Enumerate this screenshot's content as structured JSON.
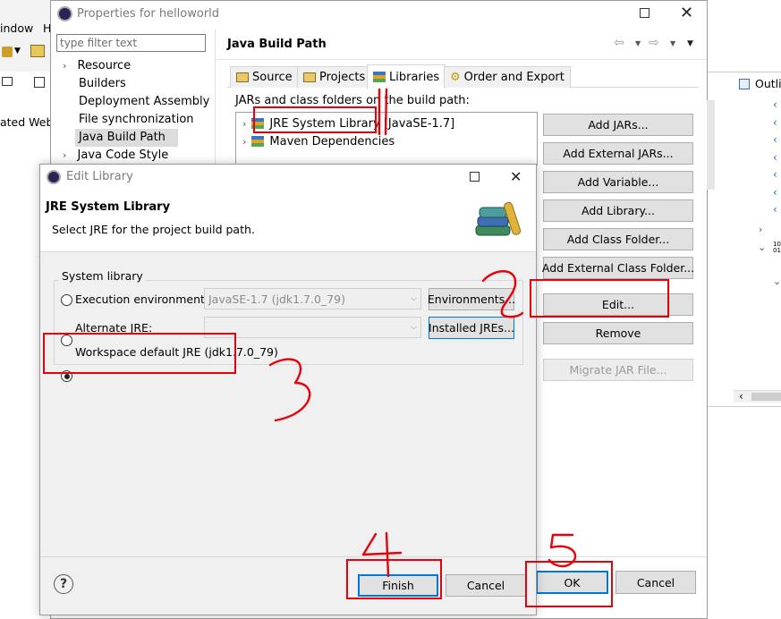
{
  "background": {
    "menu_window": "indow",
    "menu_help": "H",
    "side_text": "ated Web",
    "outline_tab": "Outli"
  },
  "properties": {
    "title": "Properties for helloworld",
    "filter_placeholder": "type filter text",
    "nav_items": [
      {
        "label": "Resource",
        "expandable": true
      },
      {
        "label": "Builders",
        "expandable": false
      },
      {
        "label": "Deployment Assembly",
        "expandable": false
      },
      {
        "label": "File synchronization",
        "expandable": false
      },
      {
        "label": "Java Build Path",
        "expandable": false,
        "selected": true
      },
      {
        "label": "Java Code Style",
        "expandable": true
      }
    ],
    "section_title": "Java Build Path",
    "tabs": [
      "Source",
      "Projects",
      "Libraries",
      "Order and Export"
    ],
    "active_tab": "Libraries",
    "jars_label": "JARs and class folders on the build path:",
    "libraries": [
      {
        "label": "JRE System Library [JavaSE-1.7]"
      },
      {
        "label": "Maven Dependencies"
      }
    ],
    "buttons": {
      "add_jars": "Add JARs...",
      "add_external_jars": "Add External JARs...",
      "add_variable": "Add Variable...",
      "add_library": "Add Library...",
      "add_class_folder": "Add Class Folder...",
      "add_external_class_folder": "Add External Class Folder...",
      "edit": "Edit...",
      "remove": "Remove",
      "migrate": "Migrate JAR File...",
      "ok": "OK",
      "cancel": "Cancel"
    }
  },
  "edit_library": {
    "title": "Edit Library",
    "header_title": "JRE System Library",
    "header_desc": "Select JRE for the project build path.",
    "group_label": "System library",
    "execution_env_label": "Execution environment:",
    "execution_env_value": "JavaSE-1.7 (jdk1.7.0_79)",
    "environments_button": "Environments...",
    "alternate_jre_label": "Alternate JRE:",
    "alternate_jre_value": "",
    "installed_jres_button": "Installed JREs...",
    "workspace_default_label": "Workspace default JRE (jdk1.7.0_79)",
    "selected_option": "workspace_default",
    "finish": "Finish",
    "cancel": "Cancel"
  },
  "annotations": [
    "1",
    "2",
    "3",
    "4",
    "5"
  ],
  "colors": {
    "annotation_red": "#e8000b",
    "focus_blue": "#0078d7",
    "selection_gray": "#dcdcdc"
  }
}
